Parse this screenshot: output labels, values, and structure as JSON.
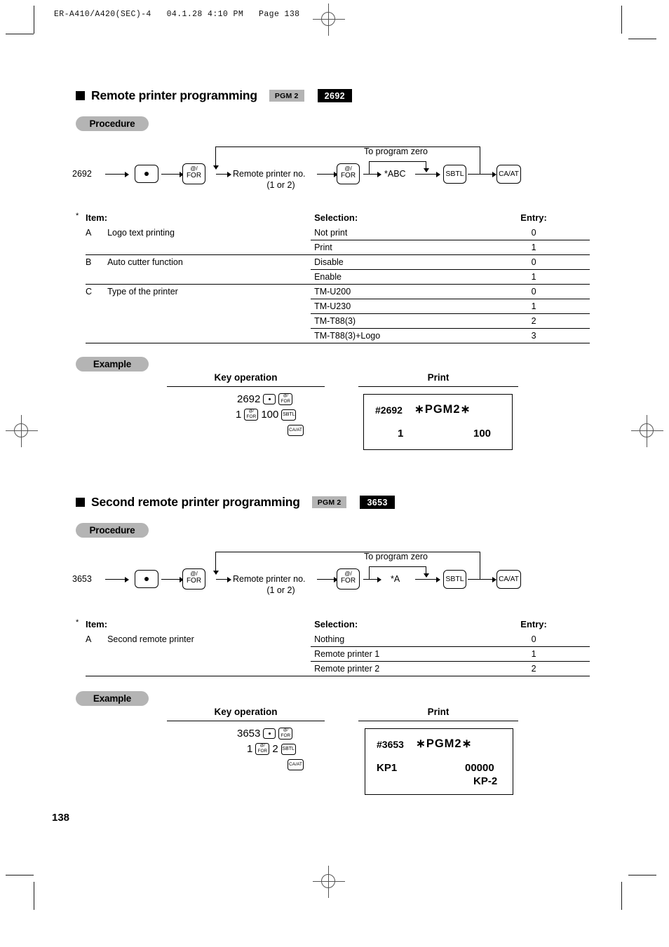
{
  "document": {
    "header": "ER-A410/A420(SEC)-4   04.1.28 4:10 PM   Page 138",
    "page_number": "138"
  },
  "colors": {
    "badge_pgm_bg": "#b4b4b4",
    "badge_num_bg": "#000000",
    "pill_bg": "#b4b4b4",
    "text": "#000000"
  },
  "sections": [
    {
      "title": "Remote printer programming",
      "badge_mode": "PGM 2",
      "badge_code": "2692",
      "procedure_label": "Procedure",
      "example_label": "Example",
      "flow": {
        "start_code": "2692",
        "key_dot": "•",
        "key_for_1": {
          "line1": "@/",
          "line2": "FOR"
        },
        "node_label_1": "Remote printer no.",
        "node_label_2": "(1 or 2)",
        "key_for_2": {
          "line1": "@/",
          "line2": "FOR"
        },
        "zero_note": "To program zero",
        "entry_label": "*ABC",
        "key_sbtl": "SBTL",
        "key_caat": "CA/AT"
      },
      "table": {
        "star": "*",
        "headers": {
          "item": "Item:",
          "selection": "Selection:",
          "entry": "Entry:"
        },
        "rows": [
          {
            "item": "A",
            "desc": "Logo text printing",
            "options": [
              {
                "selection": "Not print",
                "entry": "0"
              },
              {
                "selection": "Print",
                "entry": "1"
              }
            ]
          },
          {
            "item": "B",
            "desc": "Auto cutter function",
            "options": [
              {
                "selection": "Disable",
                "entry": "0"
              },
              {
                "selection": "Enable",
                "entry": "1"
              }
            ]
          },
          {
            "item": "C",
            "desc": "Type of the printer",
            "options": [
              {
                "selection": "TM-U200",
                "entry": "0"
              },
              {
                "selection": "TM-U230",
                "entry": "1"
              },
              {
                "selection": "TM-T88(3)",
                "entry": "2"
              },
              {
                "selection": "TM-T88(3)+Logo",
                "entry": "3"
              }
            ]
          }
        ]
      },
      "example": {
        "key_operation_header": "Key operation",
        "print_header": "Print",
        "line1_num": "2692",
        "line2_num1": "1",
        "line2_num2": "100",
        "key_dot": "•",
        "key_for": {
          "line1": "@/",
          "line2": "FOR"
        },
        "key_sbtl": "SBTL",
        "key_caat": "CA/AT",
        "receipt": {
          "id": "#2692",
          "mode": "∗PGM2∗",
          "left_value": "1",
          "right_value": "100"
        }
      }
    },
    {
      "title": "Second remote printer programming",
      "badge_mode": "PGM 2",
      "badge_code": "3653",
      "procedure_label": "Procedure",
      "example_label": "Example",
      "flow": {
        "start_code": "3653",
        "key_dot": "•",
        "key_for_1": {
          "line1": "@/",
          "line2": "FOR"
        },
        "node_label_1": "Remote printer no.",
        "node_label_2": "(1 or 2)",
        "key_for_2": {
          "line1": "@/",
          "line2": "FOR"
        },
        "zero_note": "To program zero",
        "entry_label": "*A",
        "key_sbtl": "SBTL",
        "key_caat": "CA/AT"
      },
      "table": {
        "star": "*",
        "headers": {
          "item": "Item:",
          "selection": "Selection:",
          "entry": "Entry:"
        },
        "rows": [
          {
            "item": "A",
            "desc": "Second remote printer",
            "options": [
              {
                "selection": "Nothing",
                "entry": "0"
              },
              {
                "selection": "Remote printer 1",
                "entry": "1"
              },
              {
                "selection": "Remote printer 2",
                "entry": "2"
              }
            ]
          }
        ]
      },
      "example": {
        "key_operation_header": "Key operation",
        "print_header": "Print",
        "line1_num": "3653",
        "line2_num1": "1",
        "line2_num2": "2",
        "key_dot": "•",
        "key_for": {
          "line1": "@/",
          "line2": "FOR"
        },
        "key_sbtl": "SBTL",
        "key_caat": "CA/AT",
        "receipt": {
          "id": "#3653",
          "mode": "∗PGM2∗",
          "left_value": "KP1",
          "right_value": "00000",
          "second_line": "KP-2"
        }
      }
    }
  ]
}
